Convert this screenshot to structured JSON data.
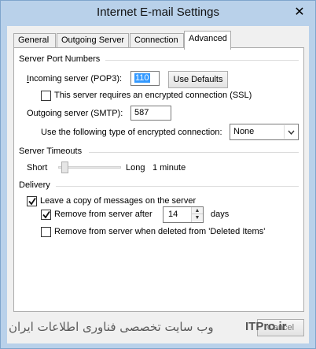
{
  "window": {
    "title": "Internet E-mail Settings",
    "close_symbol": "✕"
  },
  "tabs": [
    {
      "label": "General"
    },
    {
      "label": "Outgoing Server"
    },
    {
      "label": "Connection"
    },
    {
      "label": "Advanced"
    }
  ],
  "active_tab": "Advanced",
  "server_ports": {
    "section_title": "Server Port Numbers",
    "incoming_label": "Incoming server (POP3):",
    "incoming_value": "110",
    "use_defaults_label": "Use Defaults",
    "ssl_checkbox_label": "This server requires an encrypted connection (SSL)",
    "ssl_checked": false,
    "outgoing_label": "Outgoing server (SMTP):",
    "outgoing_value": "587",
    "encryption_label": "Use the following type of encrypted connection:",
    "encryption_value": "None"
  },
  "timeouts": {
    "section_title": "Server Timeouts",
    "short_label": "Short",
    "long_label": "Long",
    "value_label": "1 minute",
    "slider_fraction": 0.05
  },
  "delivery": {
    "section_title": "Delivery",
    "leave_copy_label": "Leave a copy of messages on the server",
    "leave_copy_checked": true,
    "remove_after_label": "Remove from server after",
    "remove_after_checked": true,
    "remove_days_value": "14",
    "days_label": "days",
    "remove_deleted_label": "Remove from server when deleted from 'Deleted Items'",
    "remove_deleted_checked": false
  },
  "footer": {
    "watermark_text": "وب سایت تخصصی فناوری اطلاعات ایران",
    "brand_text": "ITPro.ir",
    "cancel_label": "Cancel"
  },
  "colors": {
    "frame": "#b9d1ea",
    "accent": "#3399ff"
  }
}
